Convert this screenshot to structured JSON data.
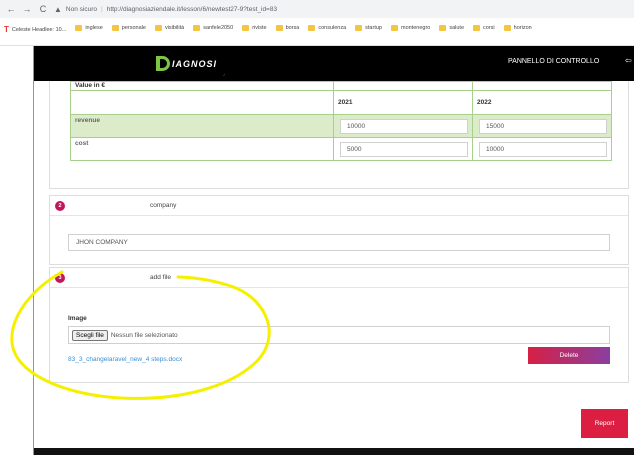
{
  "browser": {
    "nav": {
      "back": "←",
      "forward": "→",
      "reload": "C"
    },
    "security_label": "Non sicuro",
    "url": "http://diagnosiaziendale.it/lesson/6/newtest27-9?test_id=83",
    "bookmarks": [
      "Celeste Headlee: 10...",
      "inglese",
      "personale",
      "visibilità",
      "sanfele2050",
      "riviste",
      "borsa",
      "consulenza",
      "startup",
      "montenegro",
      "salute",
      "corsi",
      "horizon"
    ]
  },
  "header": {
    "logo_text": "IAGNOSI",
    "logo_sub": "✓",
    "nav_link": "PANNELLO DI CONTROLLO",
    "exit_icon": "⇦"
  },
  "table": {
    "value_label": "Value in €",
    "years": [
      "2021",
      "2022"
    ],
    "rows": [
      {
        "label": "revenue",
        "values": [
          "10000",
          "15000"
        ]
      },
      {
        "label": "cost",
        "values": [
          "5000",
          "10000"
        ]
      }
    ]
  },
  "sections": [
    {
      "number": "2",
      "title": "company",
      "input_value": "JHON COMPANY"
    },
    {
      "number": "3",
      "title": "add file",
      "image_label": "Image",
      "file_button": "Scegli file",
      "file_status": "Nessun file selezionato",
      "file_link": "83_3_changelaravel_new_4 steps.docx",
      "delete_label": "Delete"
    }
  ],
  "report_label": "Report",
  "colors": {
    "accent_green": "#7ec545",
    "table_green": "#dcebc9",
    "delete_start": "#d62045",
    "delete_end": "#8a3fa0",
    "report": "#dc1e42",
    "annotation": "#f5f000"
  }
}
